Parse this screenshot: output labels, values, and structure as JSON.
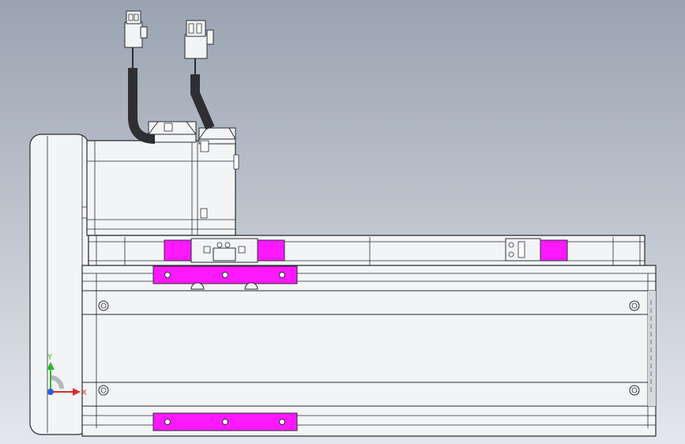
{
  "viewport": {
    "background_top": "#9aa3b1",
    "background_bottom": "#e4e7ec"
  },
  "colors": {
    "body": "#f3f4f6",
    "body_shadow": "#d4d7dc",
    "edge": "#2a2c30",
    "slot": "#fafafa",
    "magenta": "#ff19ff",
    "cable": "#2e2f33",
    "axis_y": "#2fb52f",
    "axis_x": "#d83030",
    "axis_z": "#2a5ee8"
  },
  "triad": {
    "y_label": "Y",
    "x_label": "X",
    "y_icon": "axis-y-arrow-icon",
    "x_icon": "axis-x-arrow-icon",
    "z_icon": "axis-z-dot-icon"
  }
}
